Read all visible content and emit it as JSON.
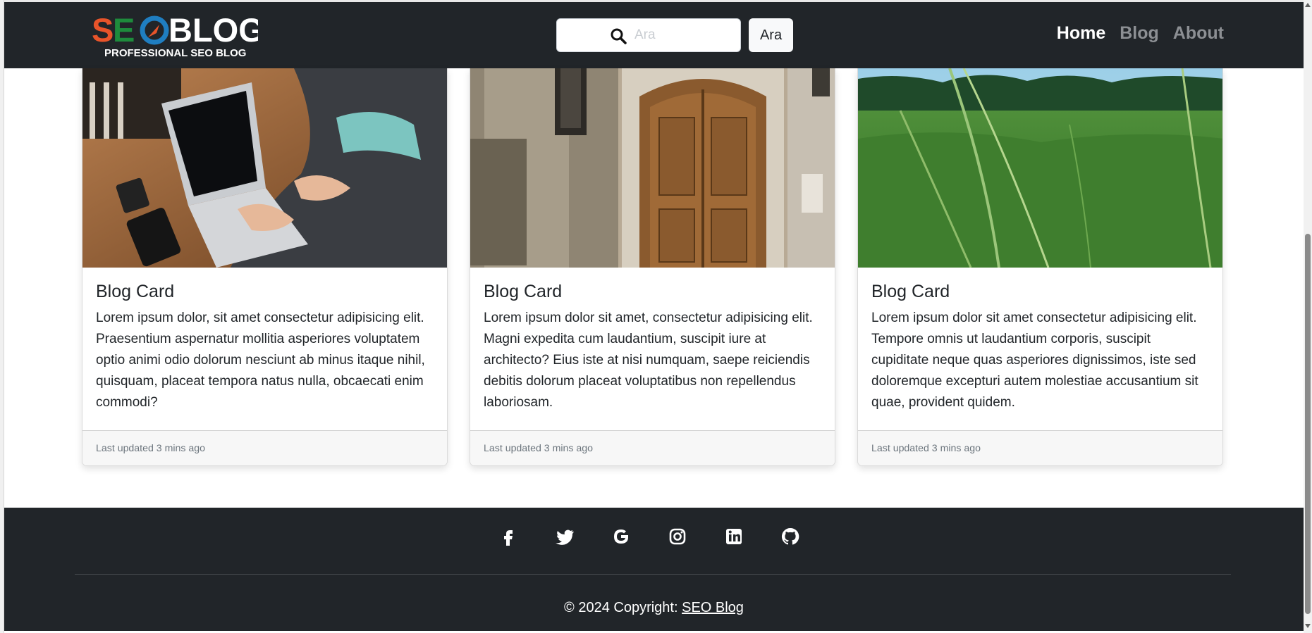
{
  "brand": {
    "logo_seo": "SEO",
    "logo_blog": "BLOG",
    "tagline": "PROFESSIONAL SEO BLOG",
    "colors": {
      "s": "#e8542a",
      "e": "#1e8b3c",
      "o": "#1f7ec1",
      "text": "#ffffff"
    }
  },
  "search": {
    "placeholder": "Ara",
    "button_label": "Ara"
  },
  "nav": {
    "items": [
      {
        "label": "Home",
        "active": true
      },
      {
        "label": "Blog",
        "active": false
      },
      {
        "label": "About",
        "active": false
      }
    ]
  },
  "cards": [
    {
      "image": "laptop-photo",
      "title": "Blog Card",
      "text": "Lorem ipsum dolor, sit amet consectetur adipisicing elit. Praesentium aspernatur mollitia asperiores voluptatem optio animi odio dolorum nesciunt ab minus itaque nihil, quisquam, placeat tempora natus nulla, obcaecati enim commodi?",
      "footer": "Last updated 3 mins ago"
    },
    {
      "image": "wooden-door-photo",
      "title": "Blog Card",
      "text": "Lorem ipsum dolor sit amet, consectetur adipisicing elit. Magni expedita cum laudantium, suscipit iure at architecto? Eius iste at nisi numquam, saepe reiciendis debitis dolorum placeat voluptatibus non repellendus laboriosam.",
      "footer": "Last updated 3 mins ago"
    },
    {
      "image": "grass-field-photo",
      "title": "Blog Card",
      "text": "Lorem ipsum dolor sit amet consectetur adipisicing elit. Tempore omnis ut laudantium corporis, suscipit cupiditate neque quas asperiores dignissimos, iste sed doloremque excepturi autem molestiae accusantium sit quae, provident quidem.",
      "footer": "Last updated 3 mins ago"
    }
  ],
  "footer": {
    "socials": [
      "facebook-icon",
      "twitter-icon",
      "google-icon",
      "instagram-icon",
      "linkedin-icon",
      "github-icon"
    ],
    "copyright_prefix": "© 2024 Copyright: ",
    "copyright_link": "SEO Blog"
  },
  "theme": {
    "dark": "#212529",
    "nav_muted": "#8c8f93"
  }
}
